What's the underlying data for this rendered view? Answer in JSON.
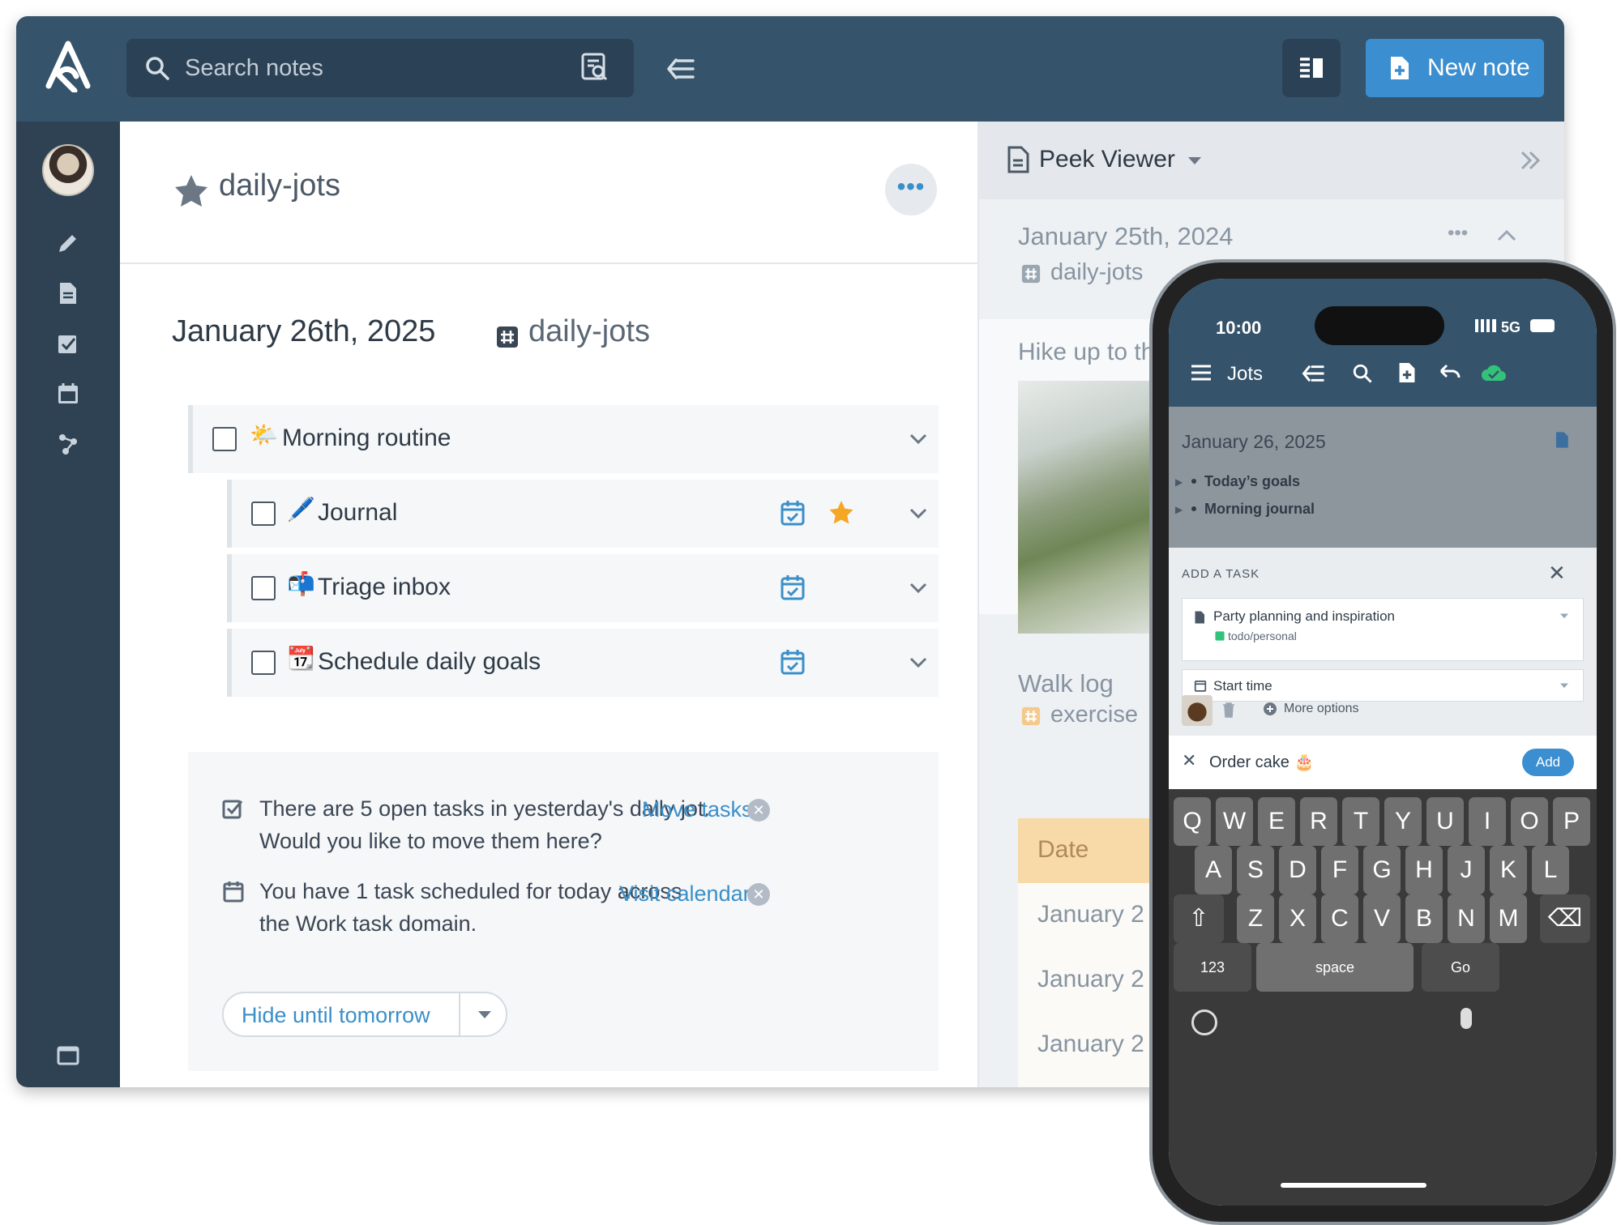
{
  "topbar": {
    "search_placeholder": "Search notes",
    "new_note_label": "New note"
  },
  "note": {
    "title": "daily-jots",
    "date_heading": "January 26th, 2025",
    "tag": "daily-jots",
    "tasks": [
      {
        "emoji": "🌤️",
        "label": "Morning routine"
      },
      {
        "emoji": "🖊️",
        "label": "Journal"
      },
      {
        "emoji": "📬",
        "label": "Triage inbox"
      },
      {
        "emoji": "📆",
        "label": "Schedule daily goals"
      }
    ],
    "notices": [
      {
        "line1": "There are 5 open tasks in yesterday's daily jot.",
        "line2": "Would you like to move them here?",
        "action": "Move tasks"
      },
      {
        "line1": "You have 1 task scheduled for today across",
        "line2": "the Work task domain.",
        "action": "Visit calendar"
      }
    ],
    "hide_button": "Hide until tomorrow"
  },
  "peek": {
    "title": "Peek Viewer",
    "entry_date": "January 25th, 2024",
    "entry_tag": "daily-jots",
    "entry_text": "Hike up to th",
    "walk_title": "Walk log",
    "walk_tag": "exercise",
    "table_header": "Date",
    "table_rows": [
      "January 2",
      "January 2",
      "January 2"
    ]
  },
  "phone": {
    "time": "10:00",
    "network": "5G",
    "app_title": "Jots",
    "note_date": "January 26, 2025",
    "items": [
      "Today’s goals",
      "Morning journal"
    ],
    "add_task_header": "ADD A TASK",
    "note_select": "Party planning and inspiration",
    "note_select_tag": "todo/personal",
    "start_time": "Start time",
    "more_options": "More options",
    "task_input": "Order cake 🎂",
    "add_button": "Add",
    "keyboard": {
      "row1": [
        "Q",
        "W",
        "E",
        "R",
        "T",
        "Y",
        "U",
        "I",
        "O",
        "P"
      ],
      "row2": [
        "A",
        "S",
        "D",
        "F",
        "G",
        "H",
        "J",
        "K",
        "L"
      ],
      "row3": [
        "Z",
        "X",
        "C",
        "V",
        "B",
        "N",
        "M"
      ],
      "num": "123",
      "space": "space",
      "go": "Go"
    }
  },
  "colors": {
    "topbar": "#35536b",
    "sidebar": "#2e4254",
    "accent": "#3b8ed0",
    "star": "#f5a623",
    "cloud_ok": "#33c27a"
  }
}
